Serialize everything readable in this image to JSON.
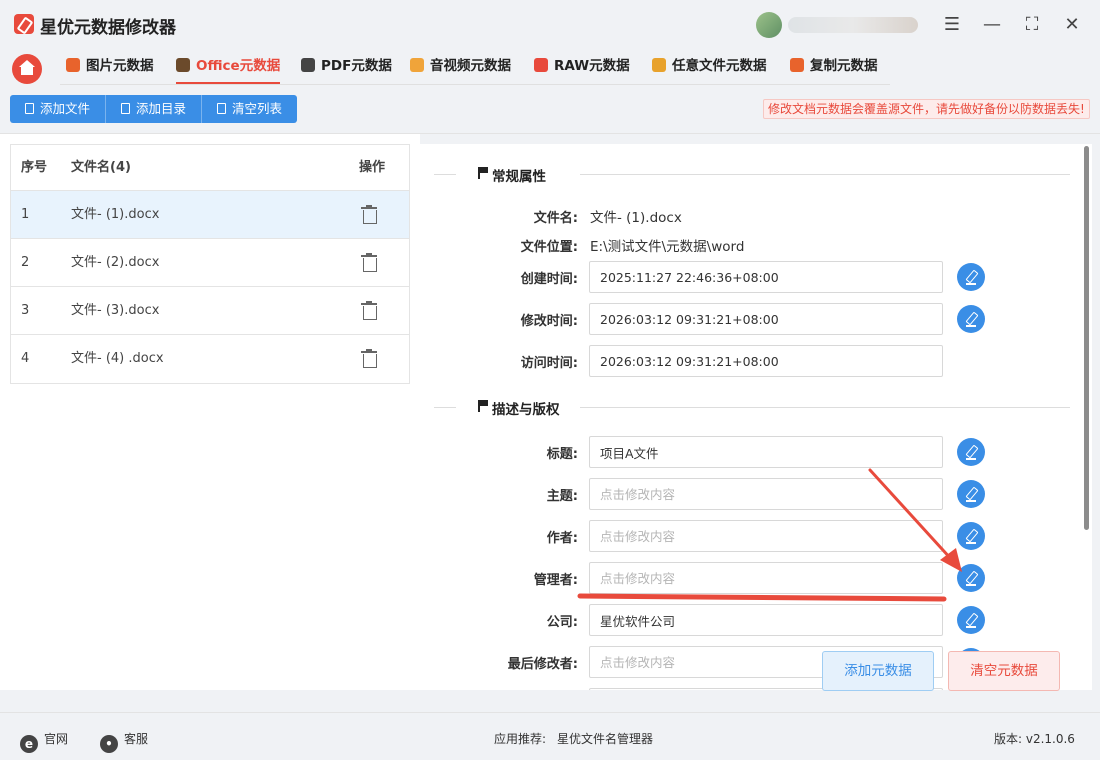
{
  "app": {
    "title": "星优元数据修改器"
  },
  "window": {
    "settings_icon": "settings-sliders-icon",
    "min_icon": "minimize-icon",
    "max_icon": "maximize-icon",
    "close_icon": "close-icon"
  },
  "nav": {
    "tabs": [
      {
        "label": "图片元数据",
        "color": "#e8632c",
        "active": false
      },
      {
        "label": "Office元数据",
        "color": "#6b4a2b",
        "active": true
      },
      {
        "label": "PDF元数据",
        "color": "#444444",
        "active": false
      },
      {
        "label": "音视频元数据",
        "color": "#f0a43a",
        "active": false
      },
      {
        "label": "RAW元数据",
        "color": "#e84a3c",
        "active": false
      },
      {
        "label": "任意文件元数据",
        "color": "#e8a22c",
        "active": false
      },
      {
        "label": "复制元数据",
        "color": "#e8632c",
        "active": false
      }
    ]
  },
  "toolbar": {
    "add_file": "添加文件",
    "add_dir": "添加目录",
    "clear_list": "清空列表",
    "warning": "修改文档元数据会覆盖源文件，请先做好备份以防数据丢失!"
  },
  "file_list": {
    "headers": {
      "index": "序号",
      "name": "文件名(4)",
      "action": "操作"
    },
    "rows": [
      {
        "index": "1",
        "name": "文件- (1).docx",
        "selected": true
      },
      {
        "index": "2",
        "name": "文件- (2).docx",
        "selected": false
      },
      {
        "index": "3",
        "name": "文件- (3).docx",
        "selected": false
      },
      {
        "index": "4",
        "name": "文件- (4) .docx",
        "selected": false
      }
    ]
  },
  "general": {
    "title": "常规属性",
    "filename_label": "文件名:",
    "filename_value": "文件- (1).docx",
    "location_label": "文件位置:",
    "location_value": "E:\\测试文件\\元数据\\word",
    "created_label": "创建时间:",
    "created_value": "2025:11:27 22:46:36+08:00",
    "modified_label": "修改时间:",
    "modified_value": "2026:03:12 09:31:21+08:00",
    "accessed_label": "访问时间:",
    "accessed_value": "2026:03:12 09:31:21+08:00"
  },
  "description": {
    "title": "描述与版权",
    "placeholder": "点击修改内容",
    "title_label": "标题:",
    "title_value": "项目A文件",
    "subject_label": "主题:",
    "author_label": "作者:",
    "manager_label": "管理者:",
    "company_label": "公司:",
    "company_value": "星优软件公司",
    "last_modified_by_label": "最后修改者:"
  },
  "actions": {
    "add_meta": "添加元数据",
    "clear_meta": "清空元数据"
  },
  "annotation": {
    "color": "#e84a3c"
  },
  "footer": {
    "website": "官网",
    "support": "客服",
    "recommend_label": "应用推荐:",
    "recommend_app": "星优文件名管理器",
    "version": "版本: v2.1.0.6"
  }
}
